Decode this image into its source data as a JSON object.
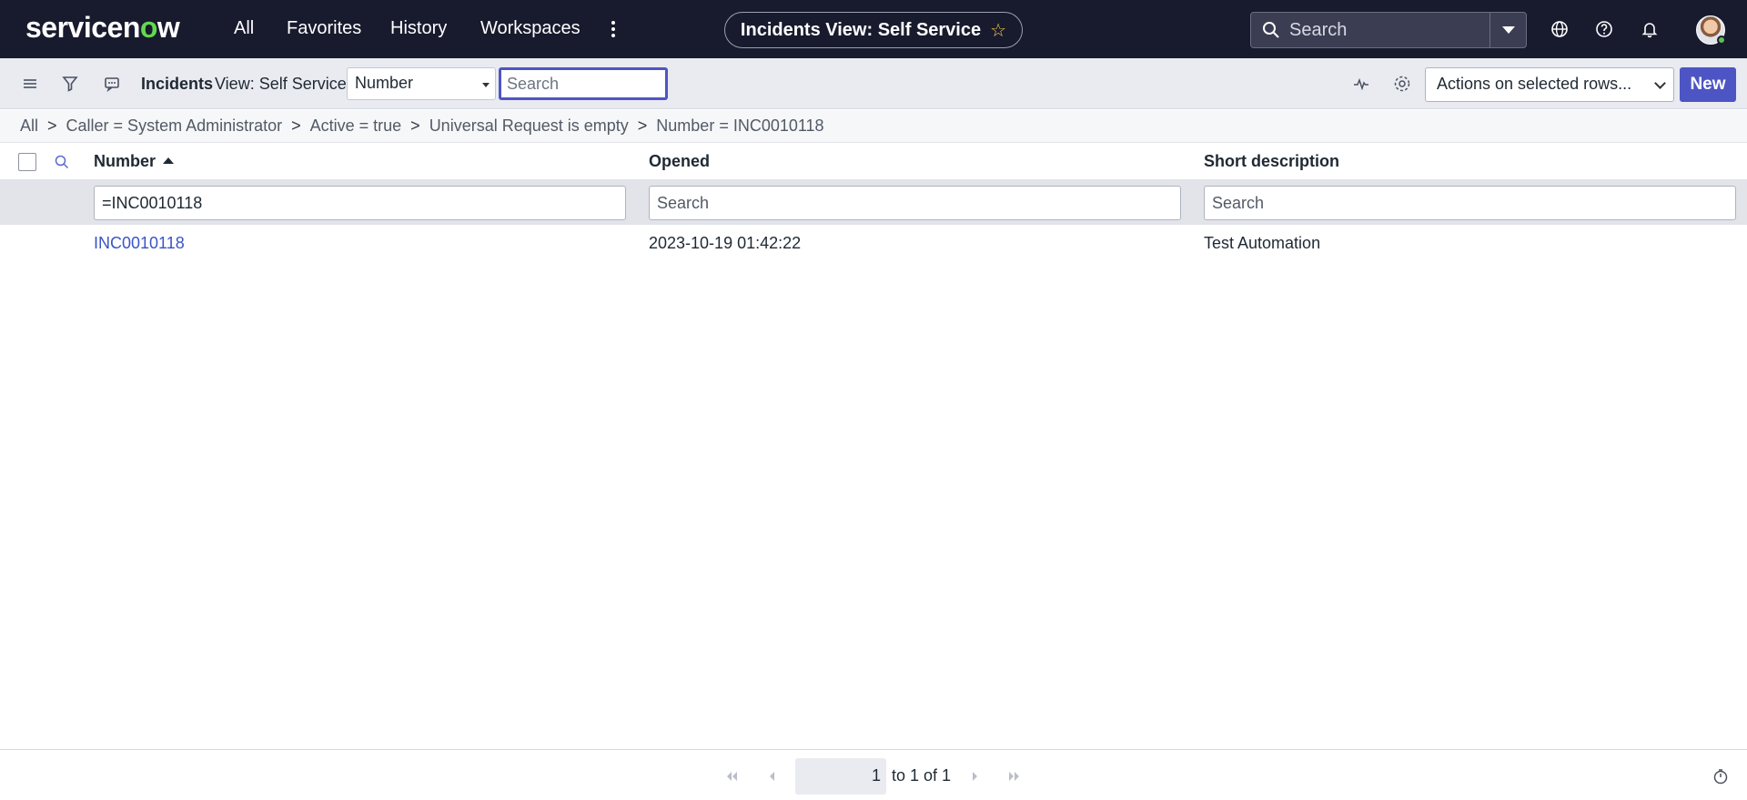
{
  "brand": {
    "logo_text_a": "servicen",
    "logo_text_o": "o",
    "logo_text_b": "w"
  },
  "topnav": {
    "menu": [
      "All",
      "Favorites",
      "History",
      "Workspaces"
    ],
    "context_title": "Incidents View: Self Service",
    "search_placeholder": "Search"
  },
  "toolbar": {
    "list_title": "Incidents",
    "view_label": "View: Self Service",
    "field_select": "Number",
    "search_placeholder": "Search",
    "actions_select": "Actions on selected rows...",
    "new_label": "New"
  },
  "breadcrumb": [
    "All",
    "Caller = System Administrator",
    "Active = true",
    "Universal Request is empty",
    "Number = INC0010118"
  ],
  "table": {
    "columns": [
      "Number",
      "Opened",
      "Short description"
    ],
    "filters": {
      "number": "=INC0010118",
      "opened_placeholder": "Search",
      "short_desc_placeholder": "Search"
    },
    "rows": [
      {
        "number": "INC0010118",
        "opened": "2023-10-19 01:42:22",
        "short_description": "Test Automation"
      }
    ]
  },
  "pagination": {
    "current_page": "1",
    "range_text": "to 1 of 1"
  },
  "colors": {
    "nav_bg": "#181a2e",
    "accent": "#4d55c4",
    "logo_green": "#62d84e",
    "link": "#3a55c6"
  }
}
